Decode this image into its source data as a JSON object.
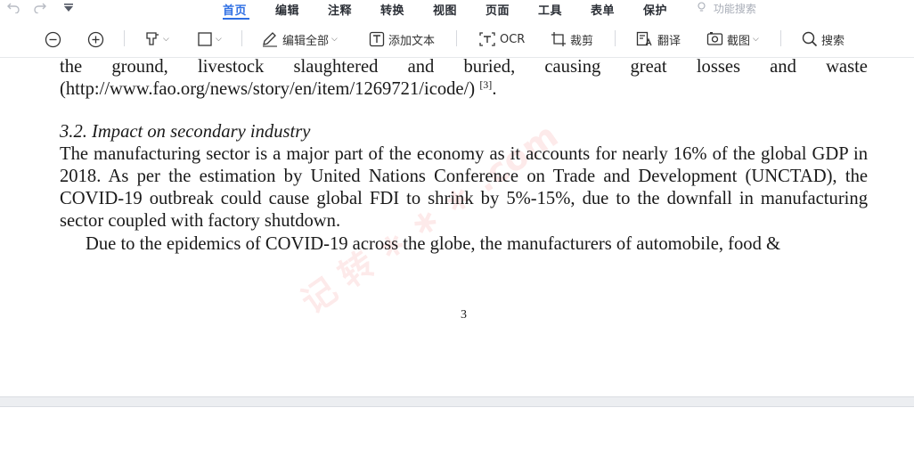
{
  "menubar": {
    "tabs": [
      {
        "label": "首页",
        "active": true
      },
      {
        "label": "编辑"
      },
      {
        "label": "注释"
      },
      {
        "label": "转换"
      },
      {
        "label": "视图"
      },
      {
        "label": "页面"
      },
      {
        "label": "工具"
      },
      {
        "label": "表单"
      },
      {
        "label": "保护"
      }
    ],
    "function_search": "功能搜索",
    "accent_color": "#2f6fe4",
    "icons": [
      "undo-icon",
      "redo-icon",
      "quick-access-dropdown-icon",
      "bulb-icon"
    ]
  },
  "toolbar": {
    "edit_all": "编辑全部",
    "add_text": "添加文本",
    "ocr": "OCR",
    "crop": "裁剪",
    "translate": "翻译",
    "screenshot": "截图",
    "search": "搜索",
    "icons": [
      "zoom-out-icon",
      "zoom-in-icon",
      "highlighter-icon",
      "select-rectangle-icon",
      "edit-pen-icon",
      "add-text-icon",
      "ocr-icon",
      "crop-icon",
      "translate-icon",
      "screenshot-icon",
      "search-icon"
    ]
  },
  "document": {
    "line1_words": [
      "the",
      "ground,",
      "livestock",
      "slaughtered",
      "and",
      "buried,",
      "causing",
      "great",
      "losses",
      "and",
      "waste"
    ],
    "line2_text": "(http://www.fao.org/news/story/en/item/1269721/icode/)",
    "line2_sup": "[3]",
    "line2_end": ".",
    "heading": "3.2. Impact on secondary industry",
    "paragraph1": "The manufacturing sector is a major part of the economy as it accounts for nearly 16% of the global GDP in 2018. As per the estimation by United Nations Conference on Trade and Development (UNCTAD), the COVID-19 outbreak could cause global FDI to shrink by 5%-15%, due to the downfall in manufacturing sector coupled with factory shutdown.",
    "paragraph2": "Due to the epidemics of COVID-19 across the globe, the manufacturers of automobile, food &",
    "page_number": "3"
  }
}
